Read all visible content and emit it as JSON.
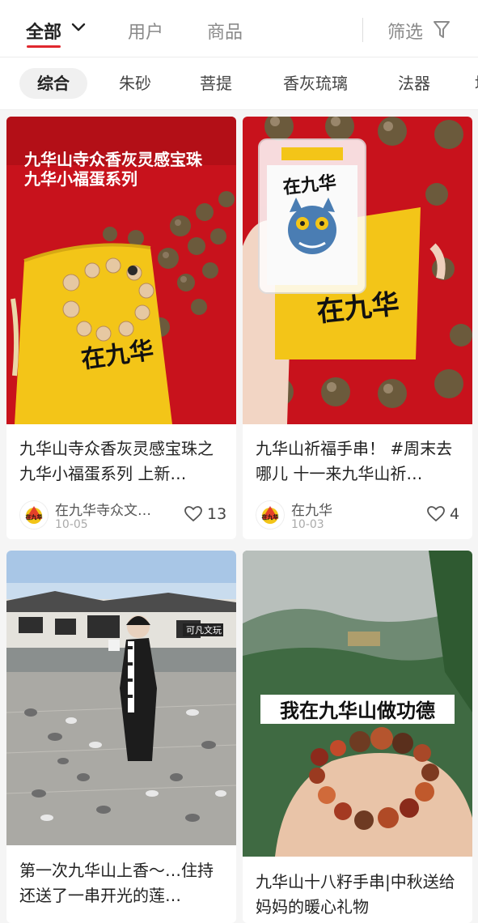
{
  "tabs": {
    "all": "全部",
    "users": "用户",
    "goods": "商品",
    "filter": "筛选"
  },
  "categories": [
    "综合",
    "朱砂",
    "菩提",
    "香灰琉璃",
    "法器",
    "坛"
  ],
  "colors": {
    "accent": "#e0282e",
    "temple_red": "#c8121c",
    "cloth_yellow": "#f3c518"
  },
  "cards": [
    {
      "overlay_text_line1": "九华山寺众香灰灵感宝珠",
      "overlay_text_line2": "九华小福蛋系列",
      "bag_brand": "在九华",
      "title": "九华山寺众香灰灵感宝珠之九华小福蛋系列 上新…",
      "author": "在九华寺众文…",
      "date": "10-05",
      "likes": "13"
    },
    {
      "card_brand": "在九华",
      "bag_brand": "在九华",
      "title": "九华山祈福手串！ #周末去哪儿 十一来九华山祈…",
      "author": "在九华",
      "date": "10-03",
      "likes": "4"
    },
    {
      "sign_text": "可凡文玩",
      "title": "第一次九华山上香～…住持还送了一串开光的莲…"
    },
    {
      "overlay_text": "我在九华山做功德",
      "title": "九华山十八籽手串|中秋送给妈妈的暖心礼物"
    }
  ],
  "avatar_text": "在九华"
}
